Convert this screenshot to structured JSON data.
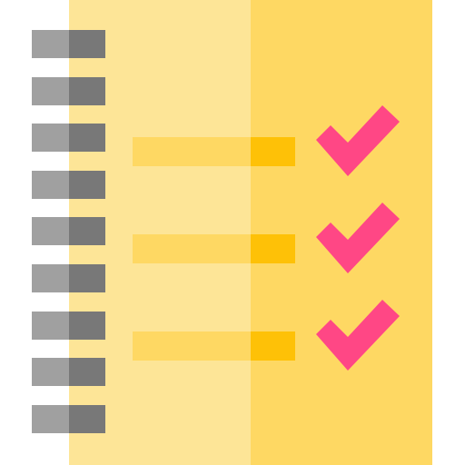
{
  "notebook": {
    "colors": {
      "page_left": "#FDE597",
      "page_right": "#FED863",
      "ring_light": "#A0A0A0",
      "ring_dark": "#787878",
      "line_main": "#FED863",
      "line_end": "#FEC107",
      "check": "#FF4785"
    },
    "spiral_rings": [
      {
        "name": "ring-1"
      },
      {
        "name": "ring-2"
      },
      {
        "name": "ring-3"
      },
      {
        "name": "ring-4"
      },
      {
        "name": "ring-5"
      },
      {
        "name": "ring-6"
      },
      {
        "name": "ring-7"
      },
      {
        "name": "ring-8"
      },
      {
        "name": "ring-9"
      }
    ],
    "checklist_items": [
      {
        "name": "item-1",
        "icon": "checkmark-icon",
        "checked": true
      },
      {
        "name": "item-2",
        "icon": "checkmark-icon",
        "checked": true
      },
      {
        "name": "item-3",
        "icon": "checkmark-icon",
        "checked": true
      }
    ]
  }
}
